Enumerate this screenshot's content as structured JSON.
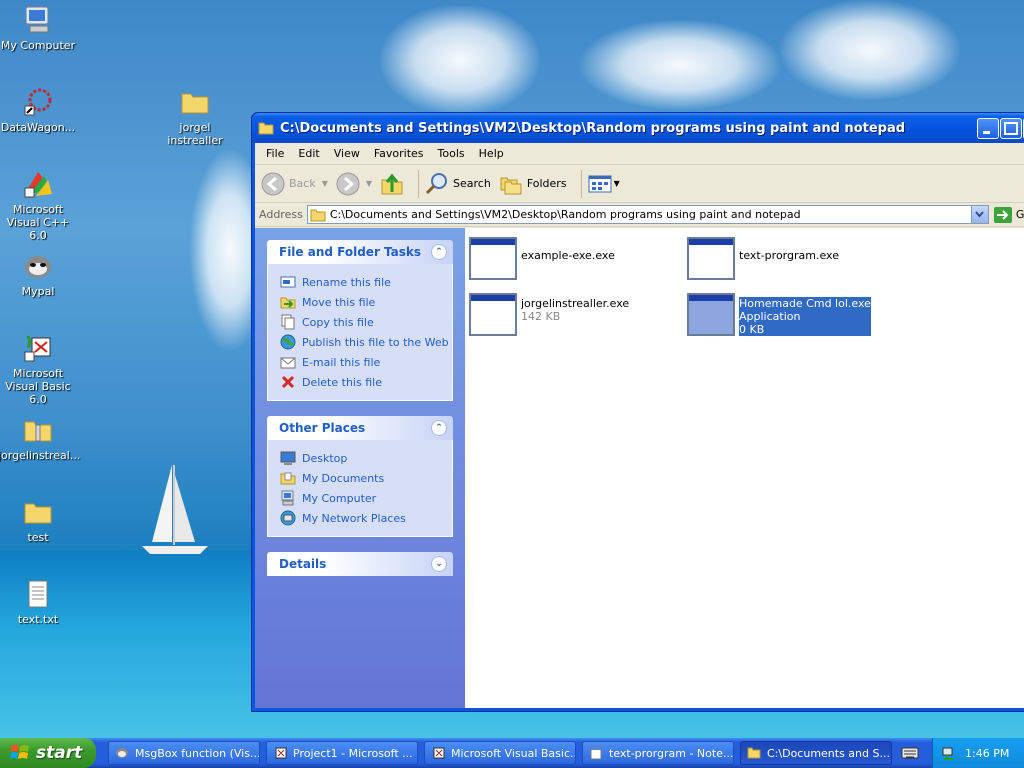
{
  "desktop": {
    "icons": [
      {
        "label": "My Computer",
        "icon": "computer-icon"
      },
      {
        "label": "DataWagon...",
        "icon": "shortcut-icon"
      },
      {
        "label": "Microsoft Visual C++ 6.0",
        "icon": "visual-cpp-icon"
      },
      {
        "label": "Mypal",
        "icon": "mypal-icon"
      },
      {
        "label": "Microsoft Visual Basic 6.0",
        "icon": "visual-basic-icon"
      },
      {
        "label": "jorgelinstreal...",
        "icon": "zip-folder-icon"
      },
      {
        "label": "test",
        "icon": "folder-icon"
      },
      {
        "label": "text.txt",
        "icon": "text-file-icon"
      },
      {
        "label": "jorgel instrealler",
        "icon": "folder-icon"
      }
    ]
  },
  "window": {
    "title": "C:\\Documents and Settings\\VM2\\Desktop\\Random programs using paint and notepad",
    "menu": [
      "File",
      "Edit",
      "View",
      "Favorites",
      "Tools",
      "Help"
    ],
    "toolbar": {
      "back": "Back",
      "search": "Search",
      "folders": "Folders"
    },
    "address": {
      "label": "Address",
      "value": "C:\\Documents and Settings\\VM2\\Desktop\\Random programs using paint and notepad",
      "go": "G"
    },
    "tasks_panel": {
      "title": "File and Folder Tasks",
      "items": [
        "Rename this file",
        "Move this file",
        "Copy this file",
        "Publish this file to the Web",
        "E-mail this file",
        "Delete this file"
      ]
    },
    "places_panel": {
      "title": "Other Places",
      "items": [
        "Desktop",
        "My Documents",
        "My Computer",
        "My Network Places"
      ]
    },
    "details_panel": {
      "title": "Details"
    },
    "files": [
      {
        "name": "example-exe.exe",
        "detail": "",
        "type": ""
      },
      {
        "name": "text-prorgram.exe",
        "detail": "",
        "type": ""
      },
      {
        "name": "jorgelinstrealler.exe",
        "detail": "142 KB",
        "type": ""
      },
      {
        "name": "Homemade Cmd lol.exe",
        "type": "Application",
        "detail": "0 KB",
        "selected": true
      }
    ]
  },
  "taskbar": {
    "start": "start",
    "buttons": [
      "MsgBox function (Vis...",
      "Project1 - Microsoft ...",
      "Microsoft Visual Basic...",
      "text-prorgram - Note...",
      "C:\\Documents and S..."
    ],
    "clock": "1:46 PM"
  },
  "colors": {
    "title_blue": "#0a54e0",
    "taskpane_link": "#215dc6",
    "selection": "#316ac5",
    "start_green": "#3c9a2e"
  }
}
